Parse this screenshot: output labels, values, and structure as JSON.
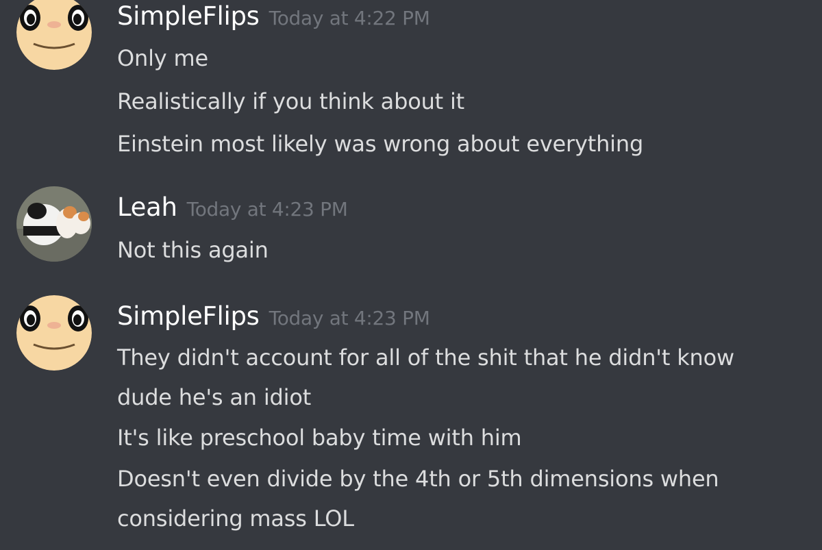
{
  "messages": [
    {
      "author": "SimpleFlips",
      "timestamp": "Today at 4:22 PM",
      "avatar_icon": "smiling-face-avatar",
      "lines": [
        "Only me",
        "Realistically if you think about it",
        "Einstein most likely was wrong about everything"
      ]
    },
    {
      "author": "Leah",
      "timestamp": "Today at 4:23 PM",
      "avatar_icon": "panda-and-cat-avatar",
      "lines": [
        "Not this again"
      ]
    },
    {
      "author": "SimpleFlips",
      "timestamp": "Today at 4:23 PM",
      "avatar_icon": "smiling-face-avatar",
      "lines": [
        "They didn't account for all of the shit that he didn't know",
        "dude he's an idiot",
        "It's like preschool baby time with him",
        "Doesn't even divide by the 4th or 5th dimensions when",
        "considering mass LOL"
      ]
    }
  ],
  "colors": {
    "background": "#36393f",
    "username": "#ffffff",
    "timestamp": "#72767d",
    "message_text": "#dcddde"
  }
}
